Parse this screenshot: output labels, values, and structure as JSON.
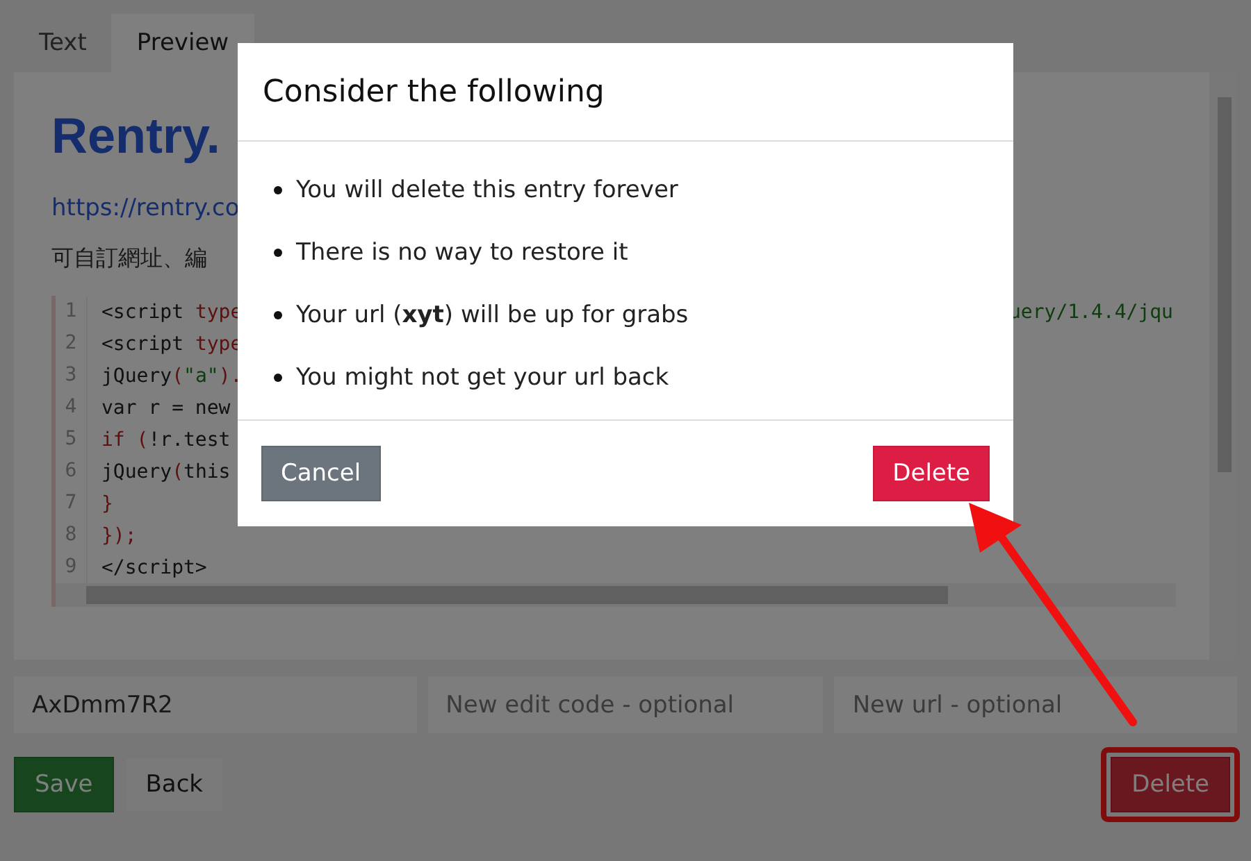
{
  "tabs": [
    {
      "label": "Text",
      "selected": false
    },
    {
      "label": "Preview",
      "selected": true
    }
  ],
  "preview": {
    "heading": "Rentry.",
    "link": "https://rentry.co",
    "paragraph": "可自訂網址、編",
    "code": {
      "lines": [
        {
          "number": "1",
          "segments": [
            {
              "t": "<script ",
              "kind": "plain"
            },
            {
              "t": "type",
              "kind": "keyword"
            }
          ],
          "tail": "uery/1.4.4/jqu"
        },
        {
          "number": "2",
          "segments": [
            {
              "t": "<script ",
              "kind": "plain"
            },
            {
              "t": "type",
              "kind": "keyword"
            }
          ]
        },
        {
          "number": "3",
          "segments": [
            {
              "t": "jQuery",
              "kind": "plain"
            },
            {
              "t": "(",
              "kind": "keyword"
            },
            {
              "t": "\"a\"",
              "kind": "string"
            },
            {
              "t": ").",
              "kind": "keyword"
            }
          ]
        },
        {
          "number": "4",
          "segments": [
            {
              "t": "var r = new",
              "kind": "plain"
            }
          ]
        },
        {
          "number": "5",
          "segments": [
            {
              "t": "if (",
              "kind": "keyword"
            },
            {
              "t": "!r.test",
              "kind": "plain"
            }
          ]
        },
        {
          "number": "6",
          "segments": [
            {
              "t": "jQuery",
              "kind": "plain"
            },
            {
              "t": "(",
              "kind": "keyword"
            },
            {
              "t": "this",
              "kind": "plain"
            }
          ]
        },
        {
          "number": "7",
          "segments": [
            {
              "t": "}",
              "kind": "keyword"
            }
          ]
        },
        {
          "number": "8",
          "segments": [
            {
              "t": "});",
              "kind": "keyword"
            }
          ]
        },
        {
          "number": "9",
          "segments": [
            {
              "t": "</script>",
              "kind": "plain"
            }
          ]
        }
      ]
    }
  },
  "fields": [
    {
      "value": "AxDmm7R2"
    },
    {
      "placeholder": "New edit code - optional"
    },
    {
      "placeholder": "New url - optional"
    }
  ],
  "actions": [
    {
      "label": "Save",
      "kind": "save",
      "highlighted": false
    },
    {
      "label": "Back",
      "kind": "back",
      "highlighted": false
    },
    {
      "label": "Delete",
      "kind": "delete",
      "highlighted": true
    }
  ],
  "modal": {
    "title": "Consider the following",
    "items": [
      "You will delete this entry forever",
      "There is no way to restore it",
      "Your url (**xyt**) will be up for grabs",
      "You might not get your url back"
    ],
    "buttons": [
      {
        "label": "Cancel",
        "kind": "cancel"
      },
      {
        "label": "Delete",
        "kind": "danger"
      }
    ]
  }
}
